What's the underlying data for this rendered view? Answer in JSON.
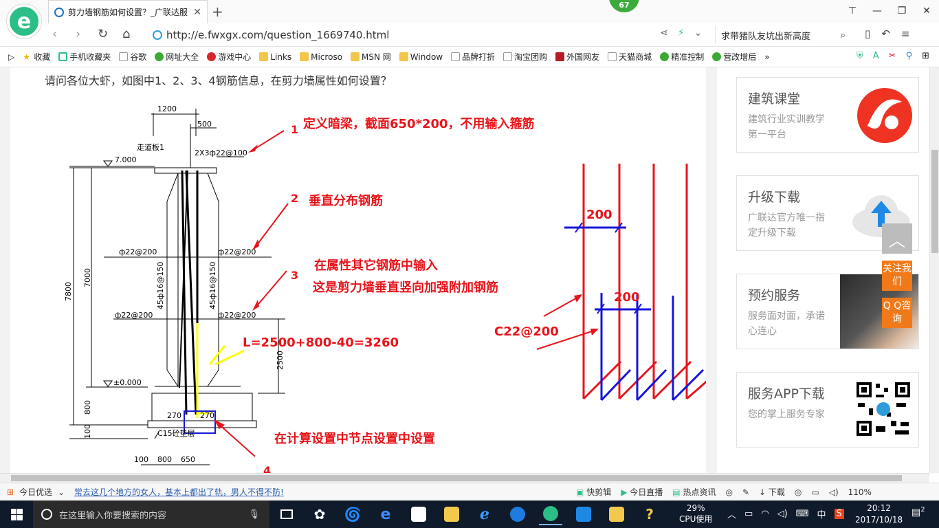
{
  "browser": {
    "badge": "67",
    "tab_title": "剪力墙钢筋如何设置？_广联达服",
    "tab_close": "✕",
    "new_tab": "+",
    "url": "http://e.fwxgx.com/question_1669740.html",
    "search_text": "求带猪队友坑出新高度",
    "bookmarks": [
      "收藏",
      "手机收藏夹",
      "谷歌",
      "网址大全",
      "游戏中心",
      "Links",
      "Microso",
      "MSN 网",
      "Window",
      "品牌打折",
      "淘宝团购",
      "外国网友",
      "天猫商城",
      "精准控制",
      "营改增后"
    ],
    "bookmarks_more": "»",
    "zoom": "110%"
  },
  "page": {
    "question": "请问各位大虾，如图中1、2、3、4钢筋信息，在剪力墙属性如何设置？"
  },
  "drawing": {
    "labels": {
      "dim_1200": "1200",
      "dim_500": "500",
      "walkway": "走道板1",
      "rebar_top": "2X3ф22@100",
      "elev_7000": "7.000",
      "dim_7800": "7800",
      "dim_7000": "7000",
      "left_22_200a": "ф22@200",
      "right_22_200a": "ф22@200",
      "left_45_16": "45ф16@150",
      "right_45_16": "45ф16@150",
      "left_22_200b": "ф22@200",
      "right_22_200b": "ф22@200",
      "dim_2500": "2500",
      "elev_0": "±0.000",
      "dim_800": "800",
      "dim_100": "100",
      "dim_270a": "270",
      "dim_270b": "270",
      "c15": "C15砼垫层",
      "bot_100": "100",
      "bot_800": "800",
      "bot_650": "650"
    },
    "annotations": {
      "n1": "1",
      "t1": "定义暗梁，截面650*200，不用输入箍筋",
      "n2": "2",
      "t2": "垂直分布钢筋",
      "n3": "3",
      "t3a": "在属性其它钢筋中输入",
      "t3b": "这是剪力墙垂直竖向加强附加钢筋",
      "len": "L=2500+800-40=3260",
      "t4": "在计算设置中节点设置中设置",
      "n4": "4",
      "dim200a": "200",
      "dim200b": "200",
      "c22": "C22@200"
    }
  },
  "sidebar": {
    "cards": [
      {
        "title": "建筑课堂",
        "subtitle": "建筑行业实训教学第一平台"
      },
      {
        "title": "升级下载",
        "subtitle": "广联达官方唯一指定升级下载"
      },
      {
        "title": "预约服务",
        "subtitle": "服务面对面，承诺心连心"
      },
      {
        "title": "服务APP下载",
        "subtitle": "您的掌上服务专家"
      }
    ],
    "float": {
      "follow": "关注我们",
      "qq": "Q Q咨询",
      "top": "︿"
    }
  },
  "statusbar": {
    "today": "今日优选",
    "news": "常去这几个地方的女人，基本上都出了轨，男人不得不防!",
    "items": [
      "快剪辑",
      "今日直播",
      "热点资讯",
      "下载"
    ]
  },
  "taskbar": {
    "search_placeholder": "在这里输入你要搜索的内容",
    "cpu_pct": "29%",
    "cpu_label": "CPU使用",
    "ime": "中",
    "time": "20:12",
    "date": "2017/10/18",
    "notifications": "2"
  },
  "colors": {
    "accent_green": "#2bbf87",
    "red": "#e8141b",
    "blue": "#1515d8",
    "orange": "#f07a1a"
  }
}
